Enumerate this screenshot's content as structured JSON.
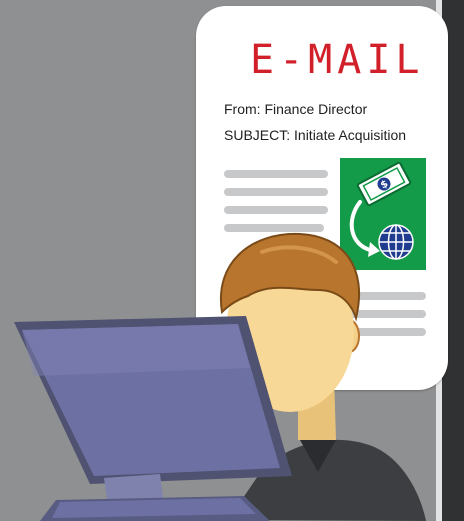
{
  "email": {
    "title": "E-MAIL",
    "from_line": "From: Finance Director",
    "subject_line": "SUBJECT: Initiate Acquisition"
  },
  "icons": {
    "money": "money-transfer-icon",
    "globe": "globe-icon"
  },
  "colors": {
    "background": "#8f9091",
    "title_red": "#d1202a",
    "icon_green": "#139b49",
    "monitor_blue": "#6d70a3",
    "hair_brown": "#b8752e",
    "skin": "#f7d896"
  }
}
